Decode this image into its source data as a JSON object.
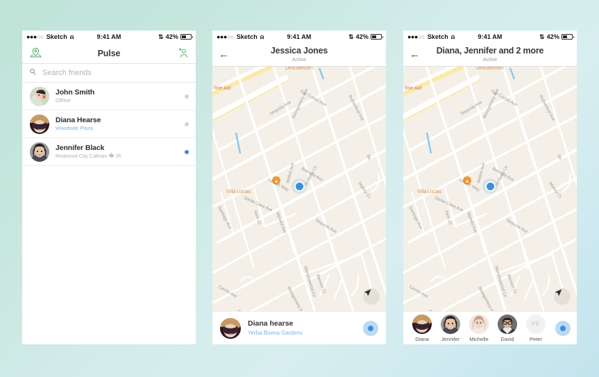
{
  "status_bar": {
    "signal_dots_filled": 3,
    "signal_dots_hollow": 2,
    "carrier": "Sketch",
    "wifi_icon": "wifi-icon",
    "time": "9:41 AM",
    "bluetooth_icon": "bluetooth-icon",
    "battery_percent": "42%",
    "battery_level": 42
  },
  "phone1": {
    "nav": {
      "left_icon": "map-pin-person-icon",
      "title": "Pulse",
      "right_icon": "add-person-icon"
    },
    "search": {
      "icon": "search-icon",
      "placeholder": "Search friends",
      "value": ""
    },
    "friends": [
      {
        "name": "John Smith",
        "subtitle": "Offline",
        "subtitle_type": "status",
        "presence": "off"
      },
      {
        "name": "Diana Hearse",
        "subtitle": "Woodside Plaza",
        "subtitle_type": "place",
        "presence": "off"
      },
      {
        "name": "Jennifer Black",
        "subtitle": "Redwood City Caltrain � 2h",
        "subtitle_type": "status",
        "presence": "on"
      }
    ]
  },
  "phone2": {
    "nav": {
      "back_icon": "back-arrow-icon",
      "title": "Jessica Jones",
      "subtitle": "Active"
    },
    "map": {
      "locate_icon": "navigation-arrow-icon",
      "user_marker": "location-dot"
    },
    "bottom_card": {
      "name": "Diana hearse",
      "place": "Yerba Buena Gardens",
      "action_icon": "locate-dot-button"
    }
  },
  "phone3": {
    "nav": {
      "back_icon": "back-arrow-icon",
      "title": "Diana, Jennifer and 2 more",
      "subtitle": "Active"
    },
    "map": {
      "locate_icon": "navigation-arrow-icon",
      "user_marker": "location-dot"
    },
    "participants": [
      {
        "name": "Diana",
        "initials": ""
      },
      {
        "name": "Jennifer",
        "initials": ""
      },
      {
        "name": "Michelle",
        "initials": ""
      },
      {
        "name": "David",
        "initials": ""
      },
      {
        "name": "Peter",
        "initials": "PE"
      }
    ],
    "action_icon": "locate-dot-button"
  },
  "map_labels": {
    "places": [
      "Rite Aid",
      "Villa Lucias",
      "Delicatessen"
    ],
    "streets": [
      "Montgomery Ave",
      "San Carlos Ave",
      "Rutherford Ave",
      "Sequoia Ave",
      "Belmont Ave",
      "Malory Ct",
      "Santa Clara Ave",
      "Santiago Ave",
      "Kerri Ct",
      "Idylwild Ave",
      "W Selby Ln",
      "Lecour Way",
      "Cerrito Ave",
      "Morningwood Cir",
      "Benson St",
      "Mellon Ave"
    ]
  },
  "colors": {
    "accent_green": "#5bab6e",
    "accent_blue": "#3b8fe0",
    "link_blue": "#7eb3e8",
    "map_bg": "#f5f1e8",
    "background_start": "#bfe3d8",
    "background_end": "#c3e3ec"
  }
}
